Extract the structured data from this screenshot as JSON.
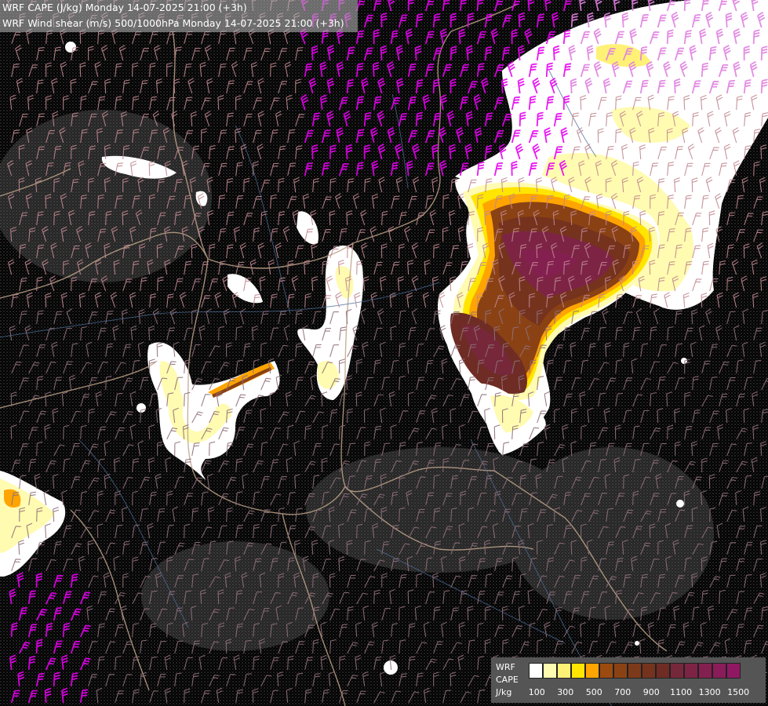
{
  "header": {
    "line1": "WRF CAPE (J/kg) Monday 14-07-2025 21:00 (+3h)",
    "line2": "WRF Wind shear (m/s) 500/1000hPa Monday 14-07-2025 21:00 (+3h)"
  },
  "legend": {
    "label_model": "WRF",
    "label_param": "CAPE",
    "label_unit": "J/kg",
    "colors": [
      "#ffffff",
      "#fffbb0",
      "#fff176",
      "#ffe500",
      "#ffa400",
      "#9b4a10",
      "#8a4214",
      "#7d3a1a",
      "#75331e",
      "#6e2c24",
      "#76283a",
      "#7d2445",
      "#84204f",
      "#8a1c59",
      "#901863"
    ],
    "ticks": [
      "100",
      "300",
      "500",
      "700",
      "900",
      "1100",
      "1300",
      "1500"
    ]
  },
  "colors": {
    "barb_weak": "#8f6f7a",
    "barb_mid": "#c08790",
    "barb_strong": "#e080e0",
    "barb_strongest": "#e600ef",
    "borders": "#c0a48a",
    "rivers": "#4c6e9a"
  }
}
